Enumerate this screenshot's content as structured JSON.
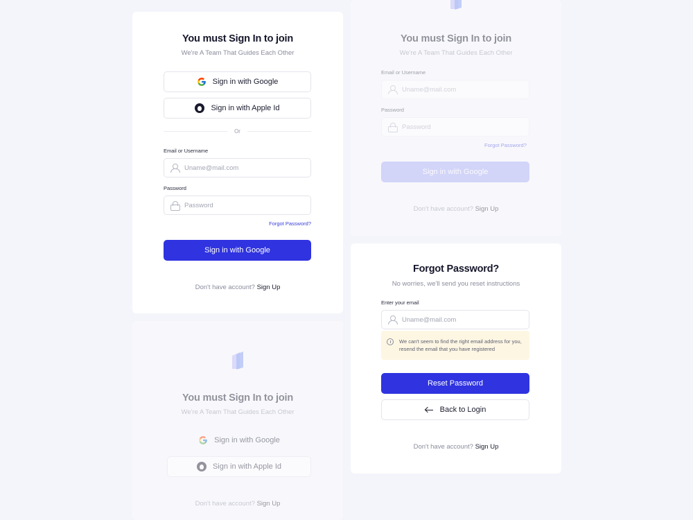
{
  "signin": {
    "title": "You must Sign In to join",
    "subtitle": "We're A Team That Guides Each Other",
    "google_label": "Sign in with Google",
    "apple_label": "Sign in with Apple Id",
    "divider": "Or",
    "email_label": "Email or Username",
    "email_placeholder": "Uname@mail.com",
    "password_label": "Password",
    "password_placeholder": "Password",
    "forgot": "Forgot Password?",
    "submit_label": "Sign in with Google",
    "footer_text": "Don't have account?",
    "footer_link": "Sign Up"
  },
  "signin_faded": {
    "title": "You must Sign In to join",
    "subtitle": "We're A Team That Guides Each Other",
    "email_label": "Email or Username",
    "email_placeholder": "Uname@mail.com",
    "password_label": "Password",
    "password_placeholder": "Password",
    "forgot": "Forgot Password?",
    "submit_label": "Sign in with Google",
    "footer_text": "Don't have account?",
    "footer_link": "Sign Up"
  },
  "social_faded": {
    "title": "You must Sign In to join",
    "subtitle": "We're A Team That Guides Each Other",
    "google_label": "Sign in with Google",
    "apple_label": "Sign in with Apple Id",
    "footer_text": "Don't have account?",
    "footer_link": "Sign Up"
  },
  "forgot": {
    "title": "Forgot Password?",
    "subtitle": "No worries, we'll send you reset instructions",
    "email_label": "Enter your email",
    "email_placeholder": "Uname@mail.com",
    "alert": "We can't seem to find the right email address for you, resend the email that you have registered",
    "reset_label": "Reset Password",
    "back_label": "Back to Login",
    "footer_text": "Don't have account?",
    "footer_link": "Sign Up"
  },
  "colors": {
    "primary": "#2f33e0",
    "primary_light": "#a6a9f4",
    "background": "#f4f5fb",
    "alert_bg": "#fdf6e3"
  }
}
